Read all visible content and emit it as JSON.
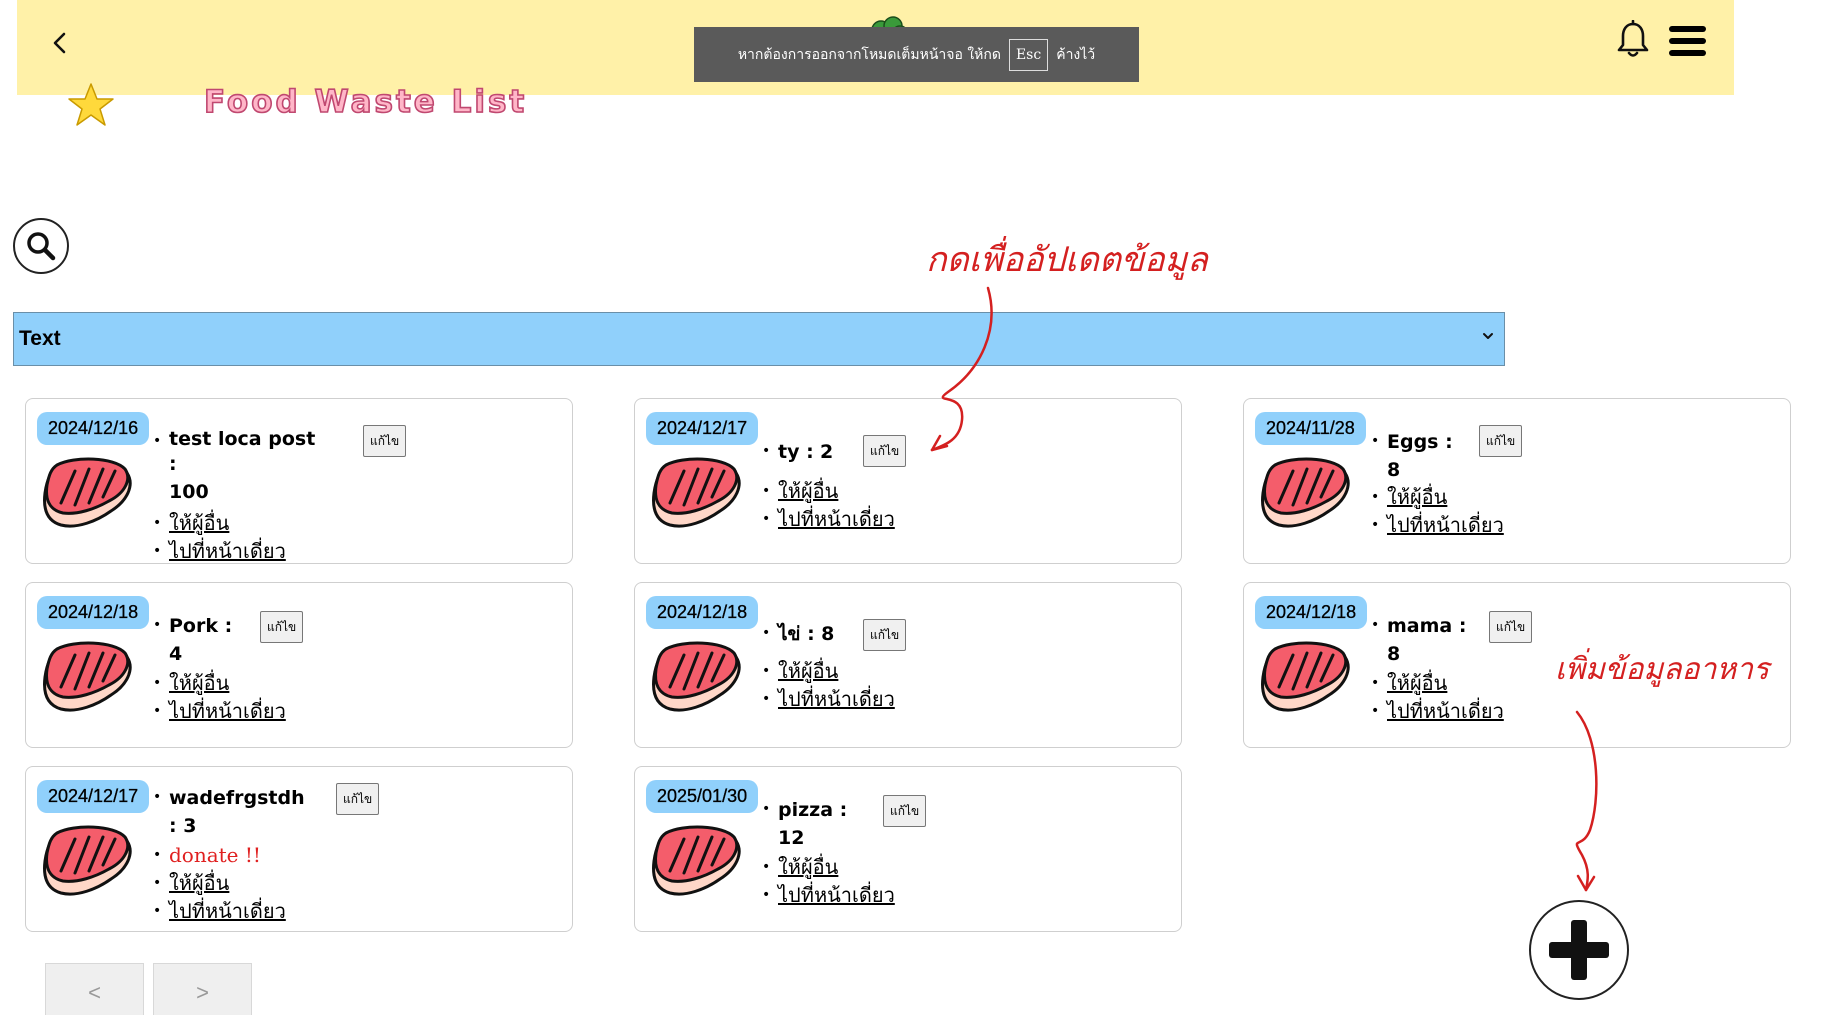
{
  "header": {
    "fullscreen_notice": {
      "text_before": "หากต้องการออกจากโหมดเต็มหน้าจอ ให้กด",
      "key": "Esc",
      "text_after": "ค้างไว้"
    }
  },
  "page_title": "Food Waste List",
  "filter": {
    "selected": "Text"
  },
  "cards": [
    {
      "date": "2024/12/16",
      "name": "test loca post :",
      "qty": "100",
      "edit": "แก้ไข",
      "donate": null,
      "give": "ให้ผู้อื่น",
      "goto": "ไปที่หน้าเดี่ยว"
    },
    {
      "date": "2024/12/17",
      "name": "ty :",
      "qty": "2",
      "edit": "แก้ไข",
      "donate": null,
      "give": "ให้ผู้อื่น",
      "goto": "ไปที่หน้าเดี่ยว"
    },
    {
      "date": "2024/11/28",
      "name": "Eggs :",
      "qty": "8",
      "edit": "แก้ไข",
      "donate": null,
      "give": "ให้ผู้อื่น",
      "goto": "ไปที่หน้าเดี่ยว"
    },
    {
      "date": "2024/12/18",
      "name": "Pork :",
      "qty": "4",
      "edit": "แก้ไข",
      "donate": null,
      "give": "ให้ผู้อื่น",
      "goto": "ไปที่หน้าเดี่ยว"
    },
    {
      "date": "2024/12/18",
      "name": "ไข่ :",
      "qty": "8",
      "edit": "แก้ไข",
      "donate": null,
      "give": "ให้ผู้อื่น",
      "goto": "ไปที่หน้าเดี่ยว"
    },
    {
      "date": "2024/12/18",
      "name": "mama :",
      "qty": "8",
      "edit": "แก้ไข",
      "donate": null,
      "give": "ให้ผู้อื่น",
      "goto": "ไปที่หน้าเดี่ยว"
    },
    {
      "date": "2024/12/17",
      "name": "wadefrgstdh",
      "qty": ": 3",
      "edit": "แก้ไข",
      "donate": "donate !!",
      "give": "ให้ผู้อื่น",
      "goto": "ไปที่หน้าเดี่ยว"
    },
    {
      "date": "2025/01/30",
      "name": "pizza :",
      "qty": "12",
      "edit": "แก้ไข",
      "donate": null,
      "give": "ให้ผู้อื่น",
      "goto": "ไปที่หน้าเดี่ยว"
    }
  ],
  "pagination": {
    "prev": "<",
    "next": ">"
  },
  "annotations": {
    "update_hint": "กดเพื่ออัปเดตข้อมูล",
    "add_hint": "เพิ่มข้อมูลอาหาร"
  },
  "colors": {
    "header_bg": "#fff1a8",
    "accent_blue": "#90d0fb",
    "title_pink": "#ffb6c8",
    "annotation_red": "#d42020",
    "donate_red": "#e02020"
  },
  "icons": {
    "back": "chevron-left-icon",
    "bell": "bell-icon",
    "menu": "hamburger-menu-icon",
    "search": "search-icon",
    "add": "plus-icon",
    "food": "steak-icon",
    "star": "star-icon"
  }
}
